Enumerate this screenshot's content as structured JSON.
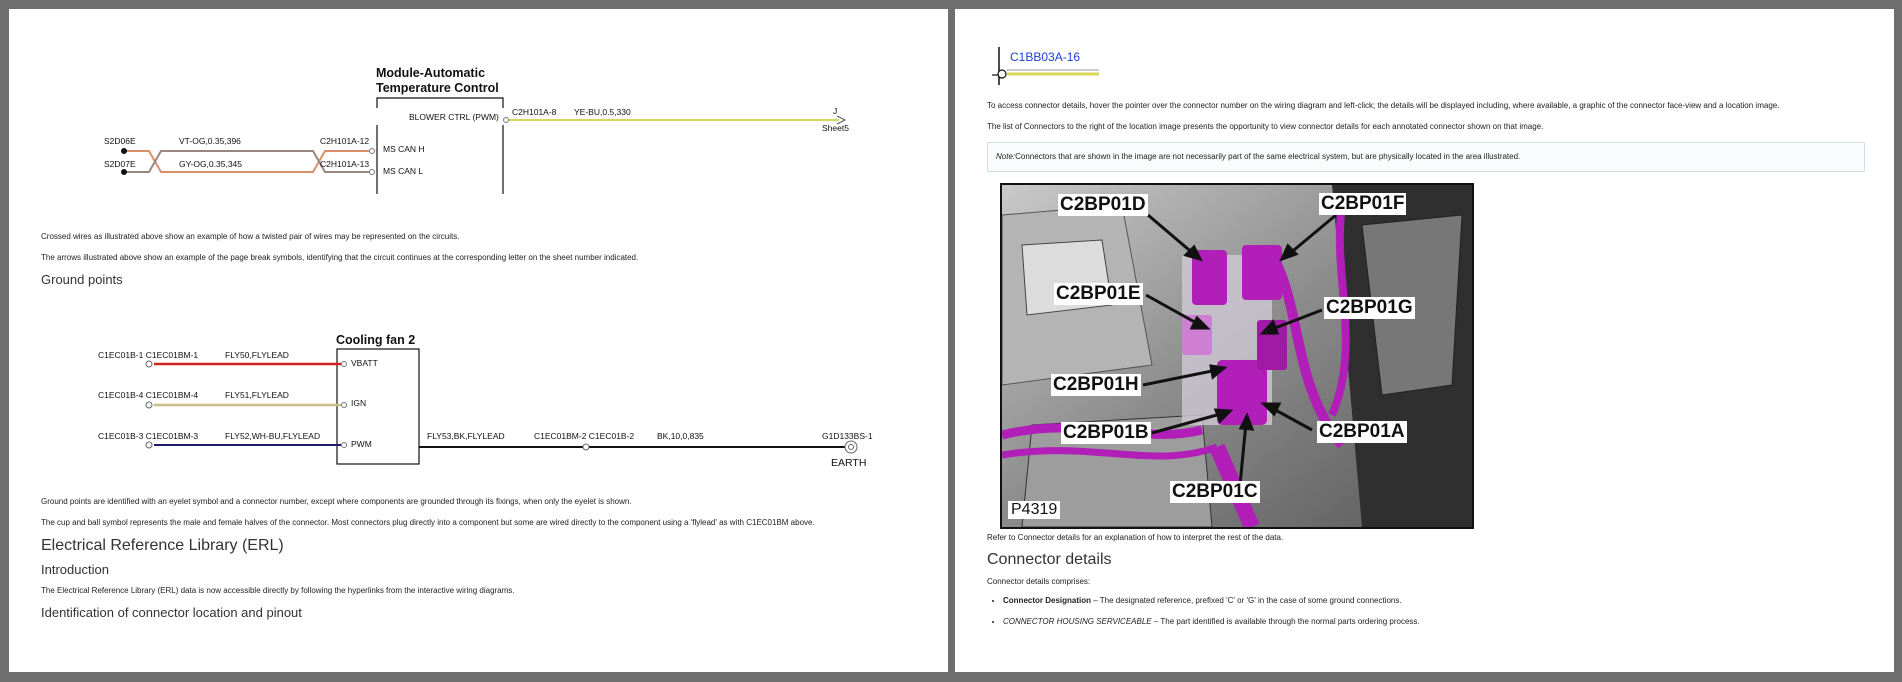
{
  "left_page": {
    "diagram1": {
      "module_title_line1": "Module-Automatic",
      "module_title_line2": "Temperature Control",
      "pin_blower": "BLOWER CTRL (PWM)",
      "pin_ms_can_h": "MS CAN H",
      "pin_ms_can_l": "MS CAN L",
      "conn_s2d06e": "S2D06E",
      "conn_s2d07e": "S2D07E",
      "wire_vt_og": "VT-OG,0.35,396",
      "wire_gy_og": "GY-OG,0.35,345",
      "conn_c2h101a_12": "C2H101A-12",
      "conn_c2h101a_13": "C2H101A-13",
      "conn_c2h101a_8": "C2H101A-8",
      "wire_ye_bu": "YE-BU,0.5,330",
      "page_break_letter": "J",
      "page_break_sheet": "Sheet5"
    },
    "para_crossed": "Crossed wires as illustrated above show an example of how a twisted pair of wires may be represented on the circuits.",
    "para_arrows": "The arrows illustrated above show an example of the page break symbols, identifying that the circuit continues at the corresponding letter on the sheet number indicated.",
    "heading_ground": "Ground points",
    "diagram2": {
      "component_title": "Cooling fan 2",
      "pin_vbatt": "VBATT",
      "pin_ign": "IGN",
      "pin_pwm": "PWM",
      "conn_row1": "C1EC01B-1 C1EC01BM-1",
      "conn_row2": "C1EC01B-4 C1EC01BM-4",
      "conn_row3": "C1EC01B-3 C1EC01BM-3",
      "wire_row1": "FLY50,FLYLEAD",
      "wire_row2": "FLY51,FLYLEAD",
      "wire_row3": "FLY52,WH-BU,FLYLEAD",
      "wire_out": "FLY53,BK,FLYLEAD",
      "conn_out": "C1EC01BM-2 C1EC01B-2",
      "wire_earth": "BK,10,0,835",
      "ground_conn": "G1D133BS-1",
      "earth_label": "EARTH"
    },
    "para_ground": "Ground points are identified with an eyelet symbol and a connector number, except where components are grounded through its fixings, when only the eyelet is shown.",
    "para_cup": "The cup and ball symbol represents the male and female halves of the connector. Most connectors plug directly into a component but some are wired directly to the component using a 'flylead' as with C1EC01BM above.",
    "heading_erl": "Electrical Reference Library (ERL)",
    "heading_intro": "Introduction",
    "para_erl": "The Electrical Reference Library (ERL) data is now accessible directly by following the hyperlinks from the interactive wiring diagrams.",
    "heading_ident": "Identification of connector location and pinout"
  },
  "right_page": {
    "connector_link": "C1BB03A-16",
    "para_access": "To access connector details, hover the pointer over the connector number on the wiring diagram and left-click; the details will be displayed including, where available, a graphic of the connector face-view and a location image.",
    "para_list": "The list of Connectors to the right of the location image presents the opportunity to view connector details for each annotated connector shown on that image.",
    "note_label": "Note:",
    "note_text": "Connectors that are shown in the image are not necessarily part of the same electrical system, but are physically located in the area illustrated.",
    "photo": {
      "callouts": [
        "C2BP01D",
        "C2BP01F",
        "C2BP01E",
        "C2BP01G",
        "C2BP01H",
        "C2BP01B",
        "C2BP01A",
        "C2BP01C"
      ],
      "image_id": "P4319"
    },
    "para_refer": "Refer to Connector details for an explanation of how to interpret the rest of the data.",
    "heading_connector": "Connector details",
    "para_comprises": "Connector details comprises:",
    "bullets": [
      {
        "term": "Connector Designation",
        "text": " – The designated reference, prefixed 'C' or 'G' in the case of some ground connections."
      },
      {
        "term": "CONNECTOR HOUSING SERVICEABLE",
        "text": " – The part identified is available through the normal parts ordering process."
      }
    ]
  },
  "colors": {
    "link_blue": "#1a3fd1",
    "wire_yellow": "#d8d65a",
    "wire_red": "#d42020",
    "wire_khaki": "#c8c088",
    "wire_navy": "#1c1c6e",
    "wire_orange": "#d8906a",
    "harness_magenta": "#b21eb8"
  }
}
